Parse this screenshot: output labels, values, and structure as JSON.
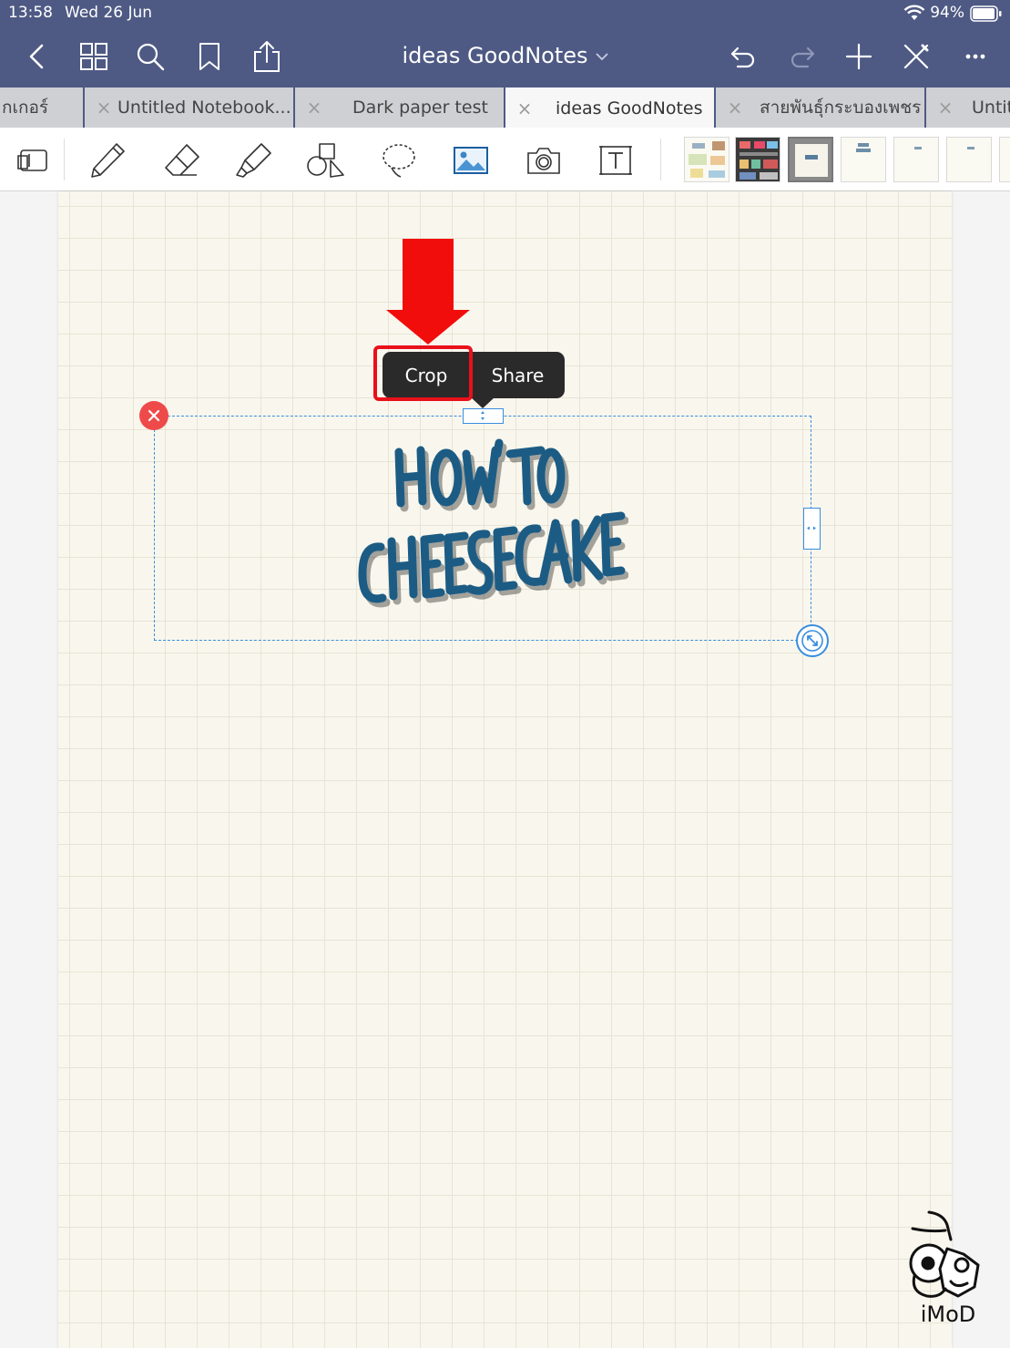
{
  "status_bar": {
    "time": "13:58",
    "date": "Wed 26 Jun",
    "battery": "94%"
  },
  "nav": {
    "title": "ideas GoodNotes",
    "icons": [
      "back-icon",
      "grid-icon",
      "search-icon",
      "bookmark-icon",
      "share-icon",
      "undo-icon",
      "redo-icon",
      "add-icon",
      "close-icon",
      "more-icon"
    ]
  },
  "tabs": [
    {
      "label": "กเกอร์"
    },
    {
      "label": "Untitled Notebook..."
    },
    {
      "label": "Dark paper test"
    },
    {
      "label": "ideas GoodNotes"
    },
    {
      "label": "สายพันธุ์กระบองเพชร"
    },
    {
      "label": "Untit"
    }
  ],
  "toolbar": {
    "tools": [
      "zoom-window-icon",
      "pen-icon",
      "eraser-icon",
      "highlighter-icon",
      "shapes-icon",
      "lasso-icon",
      "image-icon",
      "camera-icon",
      "text-icon"
    ]
  },
  "context_menu": {
    "crop": "Crop",
    "share": "Share"
  },
  "watermark": {
    "text": "iMoD"
  },
  "colors": {
    "nav_bg": "#4e5a84",
    "selection": "#3a8de0",
    "highlight": "#e8101a",
    "paper": "#f9f7ed"
  }
}
